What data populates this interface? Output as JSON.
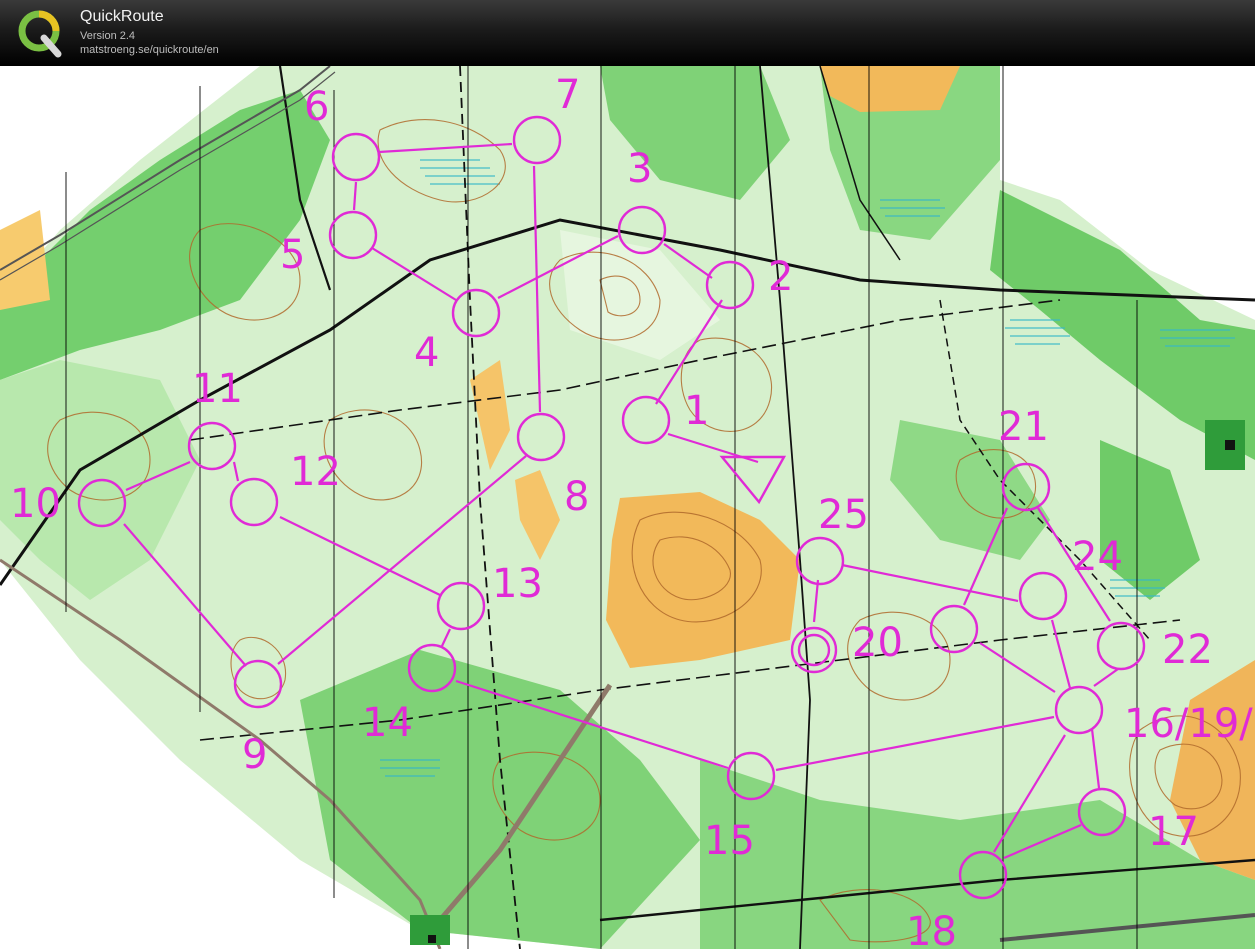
{
  "app": {
    "title": "QuickRoute",
    "version": "Version 2.4",
    "url": "matstroeng.se/quickroute/en"
  },
  "colors": {
    "course": "#e02ad6",
    "forest_green": "#4fc35a",
    "light_green": "#a9e39b",
    "open_yellow": "#f2b95a",
    "contour_brown": "#b06a2c",
    "marsh_blue": "#35b6c8"
  },
  "controls": {
    "start": "triangle",
    "finish": "double-circle",
    "labels": [
      "1",
      "2",
      "3",
      "4",
      "5",
      "6",
      "7",
      "8",
      "9",
      "10",
      "11",
      "12",
      "13",
      "14",
      "15",
      "16/19/",
      "17",
      "18",
      "20",
      "21",
      "22",
      "24",
      "25"
    ]
  },
  "icons": {
    "logo": "quickroute-q-logo"
  }
}
